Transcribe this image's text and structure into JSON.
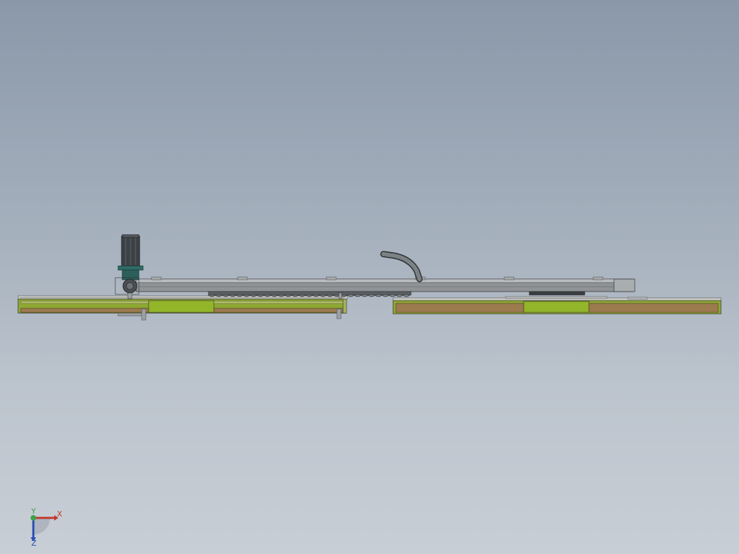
{
  "view": {
    "background_top": "#8a98a9",
    "background_bottom": "#c8ced6"
  },
  "model": {
    "rail_left_color": "#8ea833",
    "rail_wood_color": "#9b7a4e",
    "beam_color": "#8f9396",
    "motor_color": "#3c4145",
    "motor_flange_color": "#2f6b66",
    "cable_chain_color": "#6f7478"
  },
  "triad": {
    "x_label": "X",
    "y_label": "Y",
    "z_label": "Z",
    "x_color": "#c0392b",
    "y_color": "#3aa348",
    "z_color": "#2a4bb5"
  }
}
